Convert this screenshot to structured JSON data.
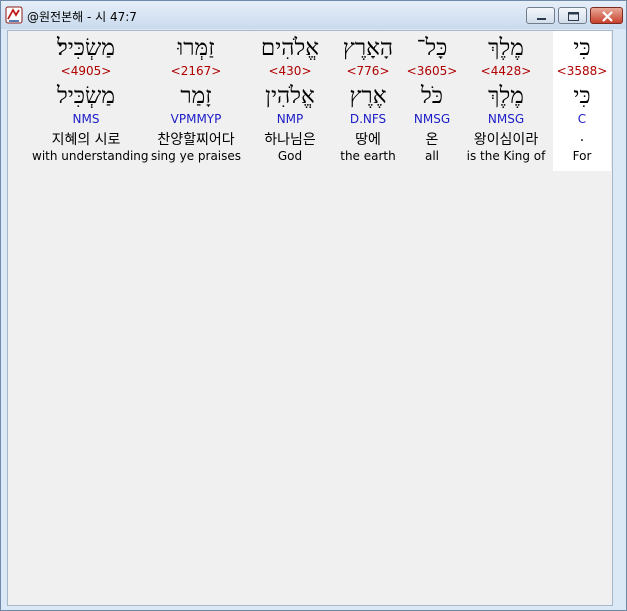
{
  "window": {
    "title": "@원전본해 - 시 47:7"
  },
  "words": [
    {
      "hebrew": "מַשְׂכִּיל׃",
      "strong": "<4905>",
      "lemma": "מַשְׂכִּיל",
      "parse": "NMS",
      "korean": "지혜의 시로",
      "english": "with understanding"
    },
    {
      "hebrew": "זַמְּרוּ",
      "strong": "<2167>",
      "lemma": "זָמַר",
      "parse": "VPMMYP",
      "korean": "찬양할찌어다",
      "english": "sing ye praises"
    },
    {
      "hebrew": "אֱלֹהִים",
      "strong": "<430>",
      "lemma": "אֱלֹהִין",
      "parse": "NMP",
      "korean": "하나님은",
      "english": "God"
    },
    {
      "hebrew": "הָאָרֶץ",
      "strong": "<776>",
      "lemma": "אֶרֶץ",
      "parse": "D.NFS",
      "korean": "땅에",
      "english": "the earth"
    },
    {
      "hebrew": "כָּל־",
      "strong": "<3605>",
      "lemma": "כֹּל",
      "parse": "NMSG",
      "korean": "온",
      "english": "all"
    },
    {
      "hebrew": "מֶלֶךְ",
      "strong": "<4428>",
      "lemma": "מֶלֶךְ",
      "parse": "NMSG",
      "korean": "왕이심이라",
      "english": "is the King of"
    },
    {
      "hebrew": "כִּי",
      "strong": "<3588>",
      "lemma": "כִּי",
      "parse": "C",
      "korean": ".",
      "english": "For"
    }
  ]
}
